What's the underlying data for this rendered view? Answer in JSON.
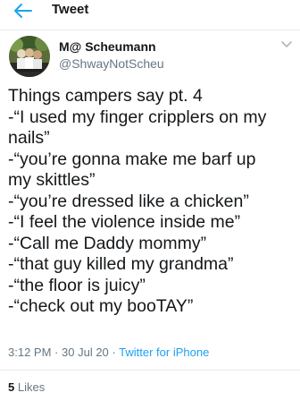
{
  "header": {
    "back_icon": "arrow-left-icon",
    "title": "Tweet",
    "accent_color": "#1da1f2"
  },
  "author": {
    "display_name": "M@ Scheumann",
    "handle": "@ShwayNotScheu"
  },
  "tweet": {
    "lines": [
      "Things campers say pt. 4",
      "-“I used my finger cripplers on my",
      "nails”",
      "-“you’re gonna make me barf up",
      "my skittles”",
      "-“you’re dressed like a chicken”",
      "-“I feel the violence inside me”",
      "-“Call me Daddy mommy”",
      "-“that guy killed my grandma”",
      "-“the floor is juicy”",
      "-“check out my booTAY”"
    ],
    "time": "3:12 PM",
    "separator": "·",
    "date": "30 Jul 20",
    "source": "Twitter for iPhone"
  },
  "stats": {
    "likes_count": "5",
    "likes_label": "Likes"
  }
}
